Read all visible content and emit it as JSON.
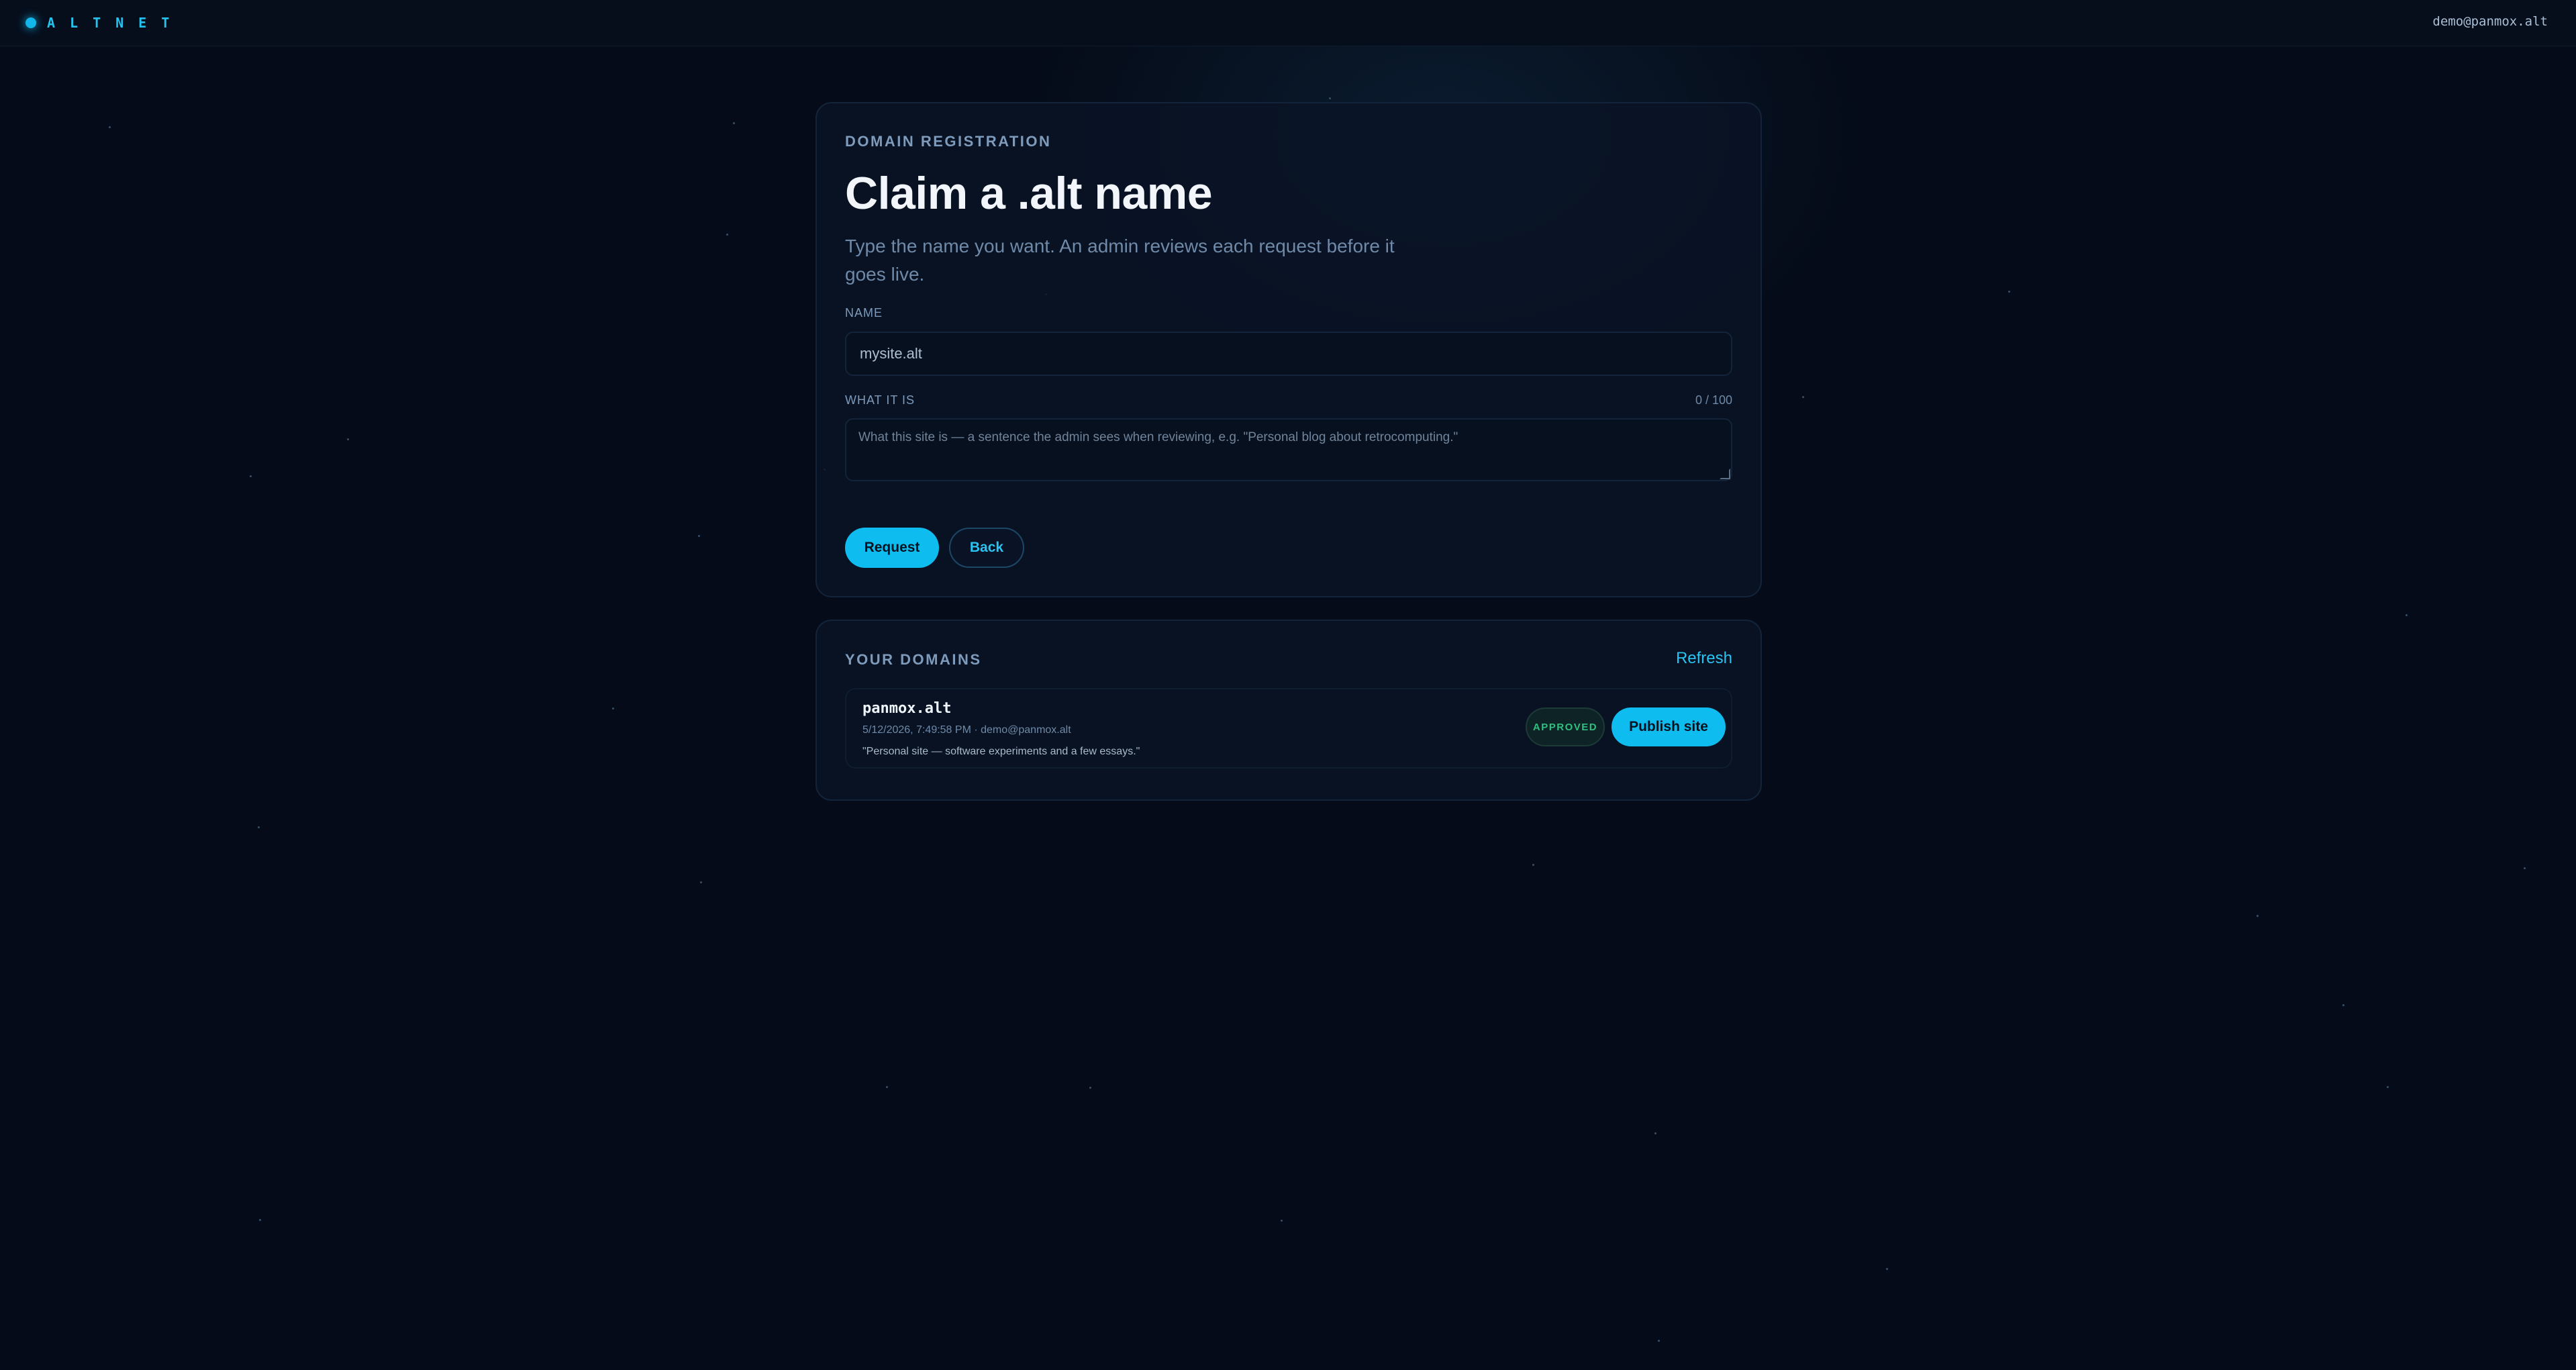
{
  "topbar": {
    "logo_text": "ALTNET",
    "user_email": "demo@panmox.alt"
  },
  "registration": {
    "eyebrow": "DOMAIN REGISTRATION",
    "title": "Claim a .alt name",
    "subtitle": "Type the name you want. An admin reviews each request before it goes live.",
    "name_label": "NAME",
    "name_value": "mysite.alt",
    "desc_label": "WHAT IT IS",
    "desc_counter": "0 / 100",
    "desc_placeholder": "What this site is — a sentence the admin sees when reviewing, e.g. \"Personal blog about retrocomputing.\"",
    "request_label": "Request",
    "back_label": "Back"
  },
  "domains": {
    "heading": "YOUR DOMAINS",
    "refresh_label": "Refresh",
    "items": [
      {
        "name": "panmox.alt",
        "meta": "5/12/2026, 7:49:58 PM · demo@panmox.alt",
        "description": "\"Personal site — software experiments and a few essays.\"",
        "status": "APPROVED",
        "action_label": "Publish site"
      }
    ]
  },
  "colors": {
    "background": "#050b18",
    "accent": "#0fbcf0",
    "approved": "#2fbf7f"
  }
}
